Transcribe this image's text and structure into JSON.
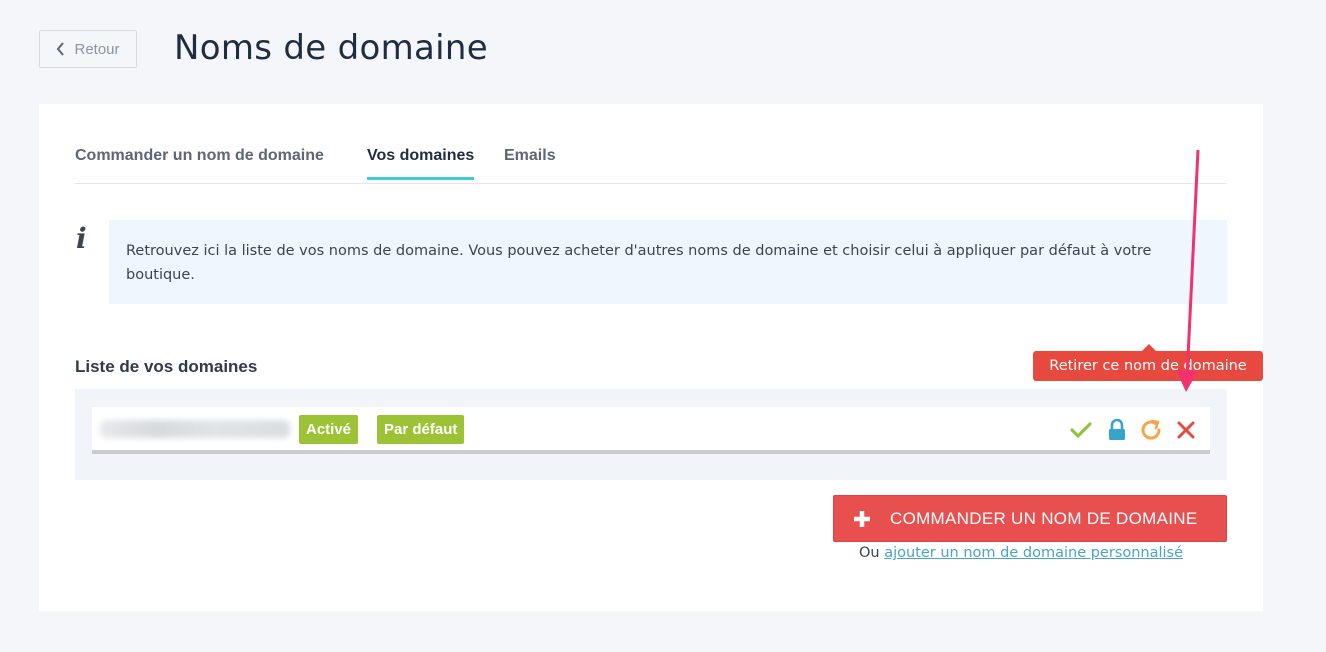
{
  "header": {
    "back_label": "Retour",
    "title": "Noms de domaine"
  },
  "tabs": [
    {
      "label": "Commander un nom de domaine",
      "active": false
    },
    {
      "label": "Vos domaines",
      "active": true
    },
    {
      "label": "Emails",
      "active": false
    }
  ],
  "info": {
    "icon": "info-icon",
    "text": "Retrouvez ici la liste de vos noms de domaine. Vous pouvez acheter d'autres noms de domaine et choisir celui à appliquer par défaut à votre boutique."
  },
  "domains": {
    "section_title": "Liste de vos domaines",
    "items": [
      {
        "name_blurred": true,
        "badges": [
          "Activé",
          "Par défaut"
        ],
        "actions": [
          "check-icon",
          "lock-icon",
          "refresh-icon",
          "close-icon"
        ]
      }
    ]
  },
  "tooltip": "Retirer ce nom de domaine",
  "order_button": "COMMANDER UN NOM DE DOMAINE",
  "footer": {
    "prefix": "Ou",
    "link": "ajouter un nom de domaine personnalisé"
  },
  "colors": {
    "accent_tab": "#3ecbd9",
    "badge_green": "#9cc335",
    "danger": "#e8504f",
    "annotation_arrow": "#f2316e",
    "check": "#8cc63f",
    "lock": "#3aa3c8",
    "refresh": "#f4a64a"
  }
}
